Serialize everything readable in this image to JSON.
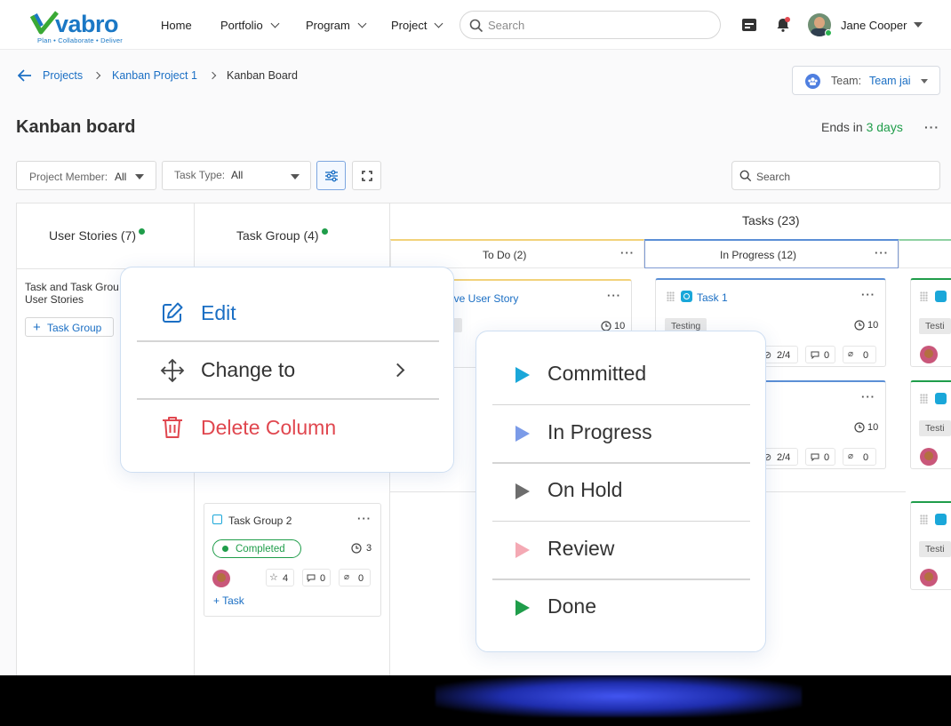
{
  "brand": {
    "name": "vabro",
    "tagline": "Plan • Collaborate • Deliver",
    "color": "#1b78c5",
    "accent": "#3aa935"
  },
  "nav": {
    "home": "Home",
    "portfolio": "Portfolio",
    "program": "Program",
    "project": "Project"
  },
  "header": {
    "search_placeholder": "Search",
    "user_name": "Jane Cooper"
  },
  "breadcrumb": {
    "projects": "Projects",
    "kanban_project": "Kanban Project 1",
    "current": "Kanban Board"
  },
  "team": {
    "label": "Team:",
    "value": "Team jai"
  },
  "page": {
    "title": "Kanban board",
    "ends_prefix": "Ends in",
    "ends_value": "3 days",
    "more": "···"
  },
  "filters": {
    "member_label": "Project Member:",
    "member_value": "All",
    "type_label": "Task Type:",
    "type_value": "All",
    "search_placeholder": "Search"
  },
  "columns": {
    "user_stories": "User Stories (7)",
    "task_group": "Task Group (4)",
    "tasks": "Tasks (23)",
    "todo": "To Do (2)",
    "in_progress": "In Progress (12)"
  },
  "left_panel": {
    "text_line1": "Task and Task Grou",
    "text_line2": "User Stories",
    "add_task_group": "Task Group"
  },
  "cards": {
    "todo_title": "ove User Story",
    "todo_time": "10",
    "task1_title": "Task 1",
    "task1_tag": "Testing",
    "task1_time": "10",
    "task1_sub": "2/4",
    "task1_comments": "0",
    "task1_attach": "0",
    "task2_time": "10",
    "task2_sub": "2/4",
    "task2_comments": "0",
    "task2_attach": "0",
    "edge_tag1": "Testi",
    "edge_tag2": "Testi",
    "edge_tag3": "Testi",
    "group2_title": "Task Group 2",
    "group2_status": "Completed",
    "group2_time": "3",
    "group2_stars": "4",
    "group2_comments": "0",
    "group2_attach": "0",
    "group2_add": "Task"
  },
  "context_menu": {
    "edit": "Edit",
    "change_to": "Change to",
    "delete": "Delete Column"
  },
  "status_menu": {
    "items": [
      {
        "label": "Committed",
        "color": "#1aa7d9"
      },
      {
        "label": "In Progress",
        "color": "#7b9be8"
      },
      {
        "label": "On Hold",
        "color": "#6d6d6d"
      },
      {
        "label": "Review",
        "color": "#f4a9b4"
      },
      {
        "label": "Done",
        "color": "#1f9d4a"
      }
    ]
  },
  "colors": {
    "link": "#1b6fc4",
    "danger": "#e0474f",
    "success": "#1f9d4a",
    "todo_bar": "#f2d27a",
    "progress_bar": "#5b8fd6"
  }
}
